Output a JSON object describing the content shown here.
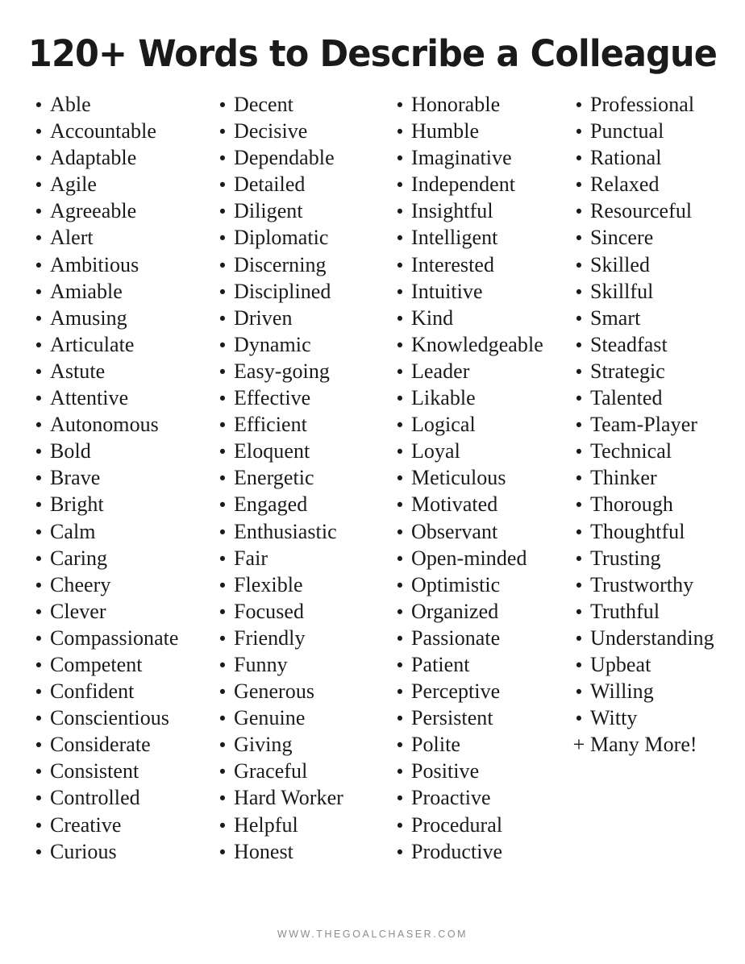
{
  "document": {
    "title": "120+ Words to Describe a Colleague",
    "title_color": "#1a1a1a",
    "background_color": "#ffffff",
    "text_color": "#1b1b1b"
  },
  "footer": {
    "website": "WWW.THEGOALCHASER.COM",
    "color": "#8d8d8d"
  },
  "bullet_glyph": "•",
  "plus_glyph": "+",
  "columns": [
    {
      "index": 1,
      "items": [
        "Able",
        "Accountable",
        "Adaptable",
        "Agile",
        "Agreeable",
        "Alert",
        "Ambitious",
        "Amiable",
        "Amusing",
        "Articulate",
        "Astute",
        "Attentive",
        "Autonomous",
        "Bold",
        "Brave",
        "Bright",
        "Calm",
        "Caring",
        "Cheery",
        "Clever",
        "Compassionate",
        "Competent",
        "Confident",
        "Conscientious",
        "Considerate",
        "Consistent",
        "Controlled",
        "Creative",
        "Curious"
      ]
    },
    {
      "index": 2,
      "items": [
        "Decent",
        "Decisive",
        "Dependable",
        "Detailed",
        "Diligent",
        "Diplomatic",
        "Discerning",
        "Disciplined",
        "Driven",
        "Dynamic",
        "Easy-going",
        "Effective",
        "Efficient",
        "Eloquent",
        "Energetic",
        "Engaged",
        "Enthusiastic",
        "Fair",
        "Flexible",
        "Focused",
        "Friendly",
        "Funny",
        "Generous",
        "Genuine",
        "Giving",
        "Graceful",
        "Hard Worker",
        "Helpful",
        "Honest"
      ]
    },
    {
      "index": 3,
      "items": [
        "Honorable",
        "Humble",
        "Imaginative",
        "Independent",
        "Insightful",
        "Intelligent",
        "Interested",
        "Intuitive",
        "Kind",
        "Knowledgeable",
        "Leader",
        "Likable",
        "Logical",
        "Loyal",
        "Meticulous",
        "Motivated",
        "Observant",
        "Open-minded",
        "Optimistic",
        "Organized",
        "Passionate",
        "Patient",
        "Perceptive",
        "Persistent",
        "Polite",
        "Positive",
        "Proactive",
        "Procedural",
        "Productive"
      ]
    },
    {
      "index": 4,
      "items": [
        "Professional",
        "Punctual",
        "Rational",
        "Relaxed",
        "Resourceful",
        "Sincere",
        "Skilled",
        "Skillful",
        "Smart",
        "Steadfast",
        "Strategic",
        "Talented",
        "Team-Player",
        "Technical",
        "Thinker",
        "Thorough",
        "Thoughtful",
        "Trusting",
        "Trustworthy",
        "Truthful",
        "Understanding",
        "Upbeat",
        "Willing",
        "Witty"
      ],
      "closing_note": "+ Many More!"
    }
  ]
}
